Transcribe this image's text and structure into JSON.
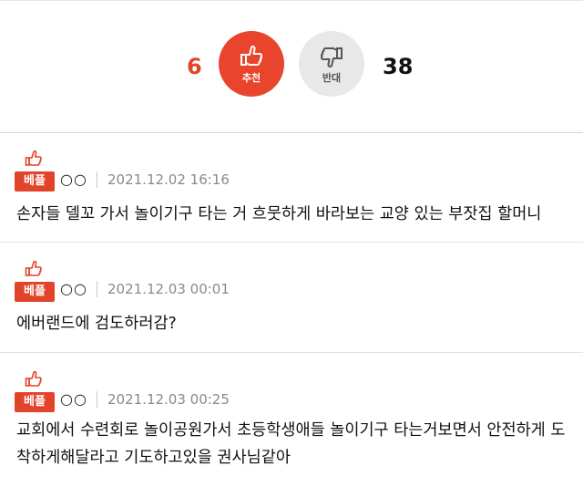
{
  "votes": {
    "up_count": "6",
    "up_label": "추천",
    "down_count": "38",
    "down_label": "반대",
    "up_color": "#e8452c",
    "down_color": "#e8e8e8"
  },
  "comments": [
    {
      "badge": "베플",
      "badge_icon": "thumbs-up-icon",
      "author": "○○",
      "date": "2021.12.02 16:16",
      "text": "손자들 델꼬 가서 놀이기구 타는 거 흐뭇하게 바라보는 교양 있는 부잣집 할머니"
    },
    {
      "badge": "베플",
      "badge_icon": "thumbs-up-icon",
      "author": "○○",
      "date": "2021.12.03 00:01",
      "text": "에버랜드에 검도하러감?"
    },
    {
      "badge": "베플",
      "badge_icon": "thumbs-up-icon",
      "author": "○○",
      "date": "2021.12.03 00:25",
      "text": "교회에서 수련회로 놀이공원가서 초등학생애들 놀이기구 타는거보면서 안전하게 도착하게해달라고 기도하고있을 권사님같아"
    }
  ]
}
